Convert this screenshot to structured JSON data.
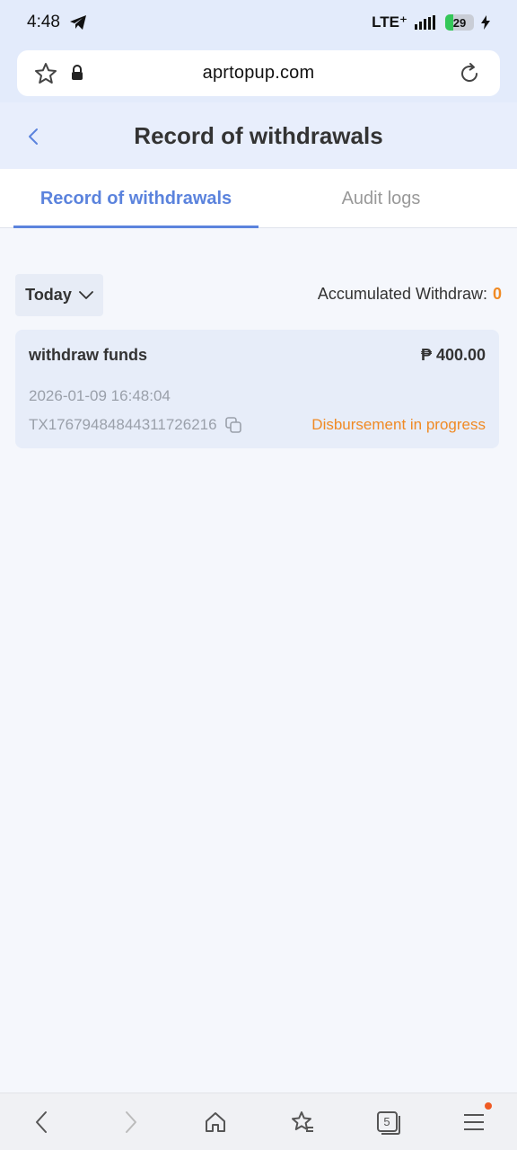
{
  "status_bar": {
    "time": "4:48",
    "network": "LTE⁺",
    "battery": "29"
  },
  "browser": {
    "url": "aprtopup.com"
  },
  "header": {
    "title": "Record of withdrawals"
  },
  "tabs": [
    {
      "label": "Record of withdrawals",
      "active": true
    },
    {
      "label": "Audit logs",
      "active": false
    }
  ],
  "filter": {
    "period": "Today",
    "accumulated_label": "Accumulated Withdraw:",
    "accumulated_value": "0"
  },
  "records": [
    {
      "title": "withdraw funds",
      "amount": "₱ 400.00",
      "datetime": "2026-01-09 16:48:04",
      "tx_id": "TX17679484844311726216",
      "status": "Disbursement in progress"
    }
  ],
  "bottom_nav": {
    "tab_count": "5"
  },
  "colors": {
    "accent": "#5b83dd",
    "status_orange": "#f08a24",
    "header_bg": "#e8eefc"
  }
}
